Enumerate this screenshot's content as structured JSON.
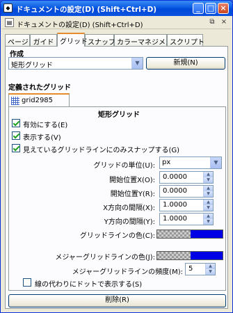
{
  "window": {
    "title": "ドキュメントの設定(D) (Shift+Ctrl+D)",
    "title_icon": "inkscape-document-icon",
    "controls": {
      "minimize": "_",
      "maximize": "□",
      "close": "×"
    }
  },
  "dock": {
    "title": "ドキュメントの設定(D) (Shift+Ctrl+D)",
    "icon": "document-properties-icon",
    "btn_iconify": "⧉",
    "btn_close": "×"
  },
  "tabs": [
    {
      "label": "ページ"
    },
    {
      "label": "ガイド"
    },
    {
      "label": "グリッド"
    },
    {
      "label": "スナップ"
    },
    {
      "label": "カラーマネジメント"
    },
    {
      "label": "スクリプト"
    }
  ],
  "create": {
    "title": "作成",
    "type_value": "矩形グリッド",
    "new_button": "新規(N)"
  },
  "defined": {
    "title": "定義されたグリッド",
    "grid_tab_label": "grid2985"
  },
  "grid": {
    "heading": "矩形グリッド",
    "enabled_label": "有効にする(E)",
    "enabled": true,
    "visible_label": "表示する(V)",
    "visible": true,
    "snap_visible_label": "見えているグリッドラインにのみスナップする(G)",
    "snap_visible": true,
    "unit_label": "グリッドの単位(U):",
    "unit_value": "px",
    "origin_x_label": "開始位置X(O):",
    "origin_x": "0.0000",
    "origin_y_label": "開始位置Y(R):",
    "origin_y": "0.0000",
    "spacing_x_label": "X方向の間隔(X):",
    "spacing_x": "1.0000",
    "spacing_y_label": "Y方向の間隔(Y):",
    "spacing_y": "1.0000",
    "line_color_label": "グリッドラインの色(C):",
    "line_color": "#0000e6",
    "major_color_label": "メジャーグリッドラインの色(J):",
    "major_color": "#0000e6",
    "major_every_label": "メジャーグリッドラインの頻度(M):",
    "major_every": "5",
    "dots_label": "線の代わりにドットで表示する(S)",
    "dots": false
  },
  "delete_button": "削除(R)"
}
